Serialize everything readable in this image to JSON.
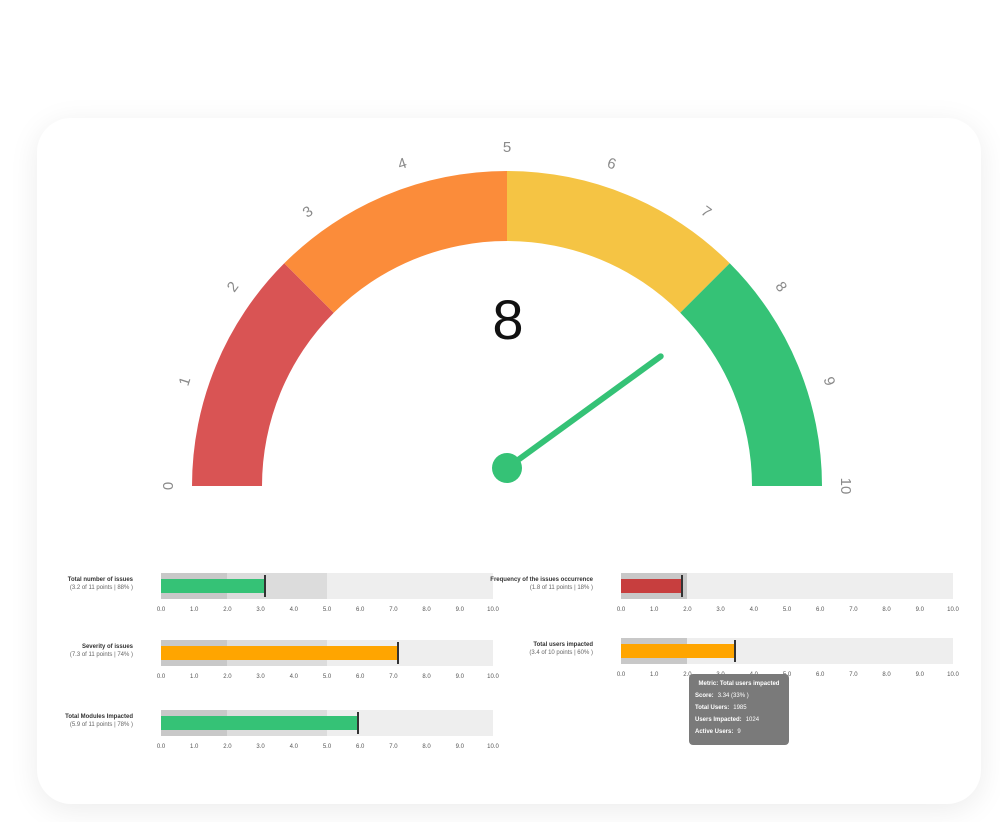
{
  "gauge": {
    "min": 0,
    "max": 10,
    "value": 8,
    "display_value": "8",
    "tick_labels": [
      "0",
      "1",
      "2",
      "3",
      "4",
      "5",
      "6",
      "7",
      "8",
      "9",
      "10"
    ],
    "bands": [
      {
        "from": 0,
        "to": 2.5,
        "color": "#d95454"
      },
      {
        "from": 2.5,
        "to": 5,
        "color": "#fb8c3a"
      },
      {
        "from": 5,
        "to": 7.5,
        "color": "#f5c444"
      },
      {
        "from": 7.5,
        "to": 10,
        "color": "#35c276"
      }
    ],
    "needle_color": "#35c276"
  },
  "axis_ticks": [
    "0.0",
    "1.0",
    "2.0",
    "3.0",
    "4.0",
    "5.0",
    "6.0",
    "7.0",
    "8.0",
    "9.0",
    "10.0"
  ],
  "metrics": [
    {
      "id": "total-issues",
      "title": "Total number of issues",
      "subtitle": "(3.2 of 11 points | 88% )",
      "bands": [
        2.0,
        5.0
      ],
      "value": 3.1,
      "color": "#35c276"
    },
    {
      "id": "severity",
      "title": "Severity of issues",
      "subtitle": "(7.3 of 11 points | 74% )",
      "bands": [
        2.0,
        5.0
      ],
      "value": 7.1,
      "color": "#ffa500"
    },
    {
      "id": "modules",
      "title": "Total Modules Impacted",
      "subtitle": "(5.9 of 11 points | 78% )",
      "bands": [
        2.0,
        5.0
      ],
      "value": 5.9,
      "color": "#35c276"
    },
    {
      "id": "frequency",
      "title": "Frequency of the issues occurrence",
      "subtitle": "(1.8 of 11 points | 18% )",
      "bands": [
        2.0
      ],
      "value": 1.8,
      "color": "#c73e3e"
    },
    {
      "id": "users",
      "title": "Total users impacted",
      "subtitle": "(3.4 of 10 points | 60% )",
      "bands": [
        2.0
      ],
      "value": 3.4,
      "color": "#ffa500"
    }
  ],
  "tooltip": {
    "title": "Metric: Total users impacted",
    "rows": [
      {
        "label": "Score:",
        "value": "3.34 (33% )"
      },
      {
        "label": "Total Users:",
        "value": "1985"
      },
      {
        "label": "Users Impacted:",
        "value": "1024"
      },
      {
        "label": "Active Users:",
        "value": "9"
      }
    ]
  }
}
